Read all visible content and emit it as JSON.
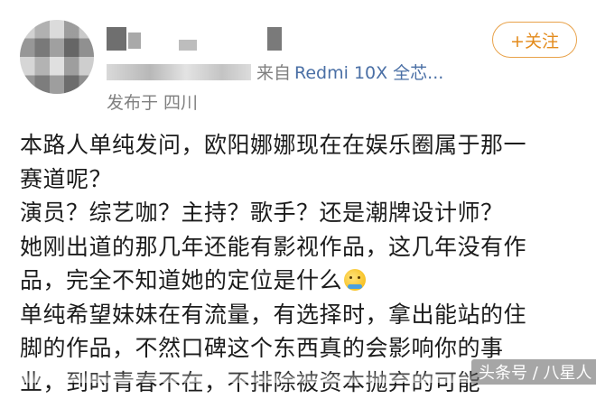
{
  "post": {
    "meta": {
      "source_label": "来自",
      "device": "Redmi 10X 全芯...",
      "location": "发布于 四川"
    },
    "follow_label": "+关注",
    "lines": [
      "本路人单纯发问，欧阳娜娜现在在娱乐圈属于那一",
      "赛道呢？",
      "演员？综艺咖？主持？歌手？还是潮牌设计师？",
      "她刚出道的那几年还能有影视作品，这几年没有作",
      "品，完全不知道她的定位是什么",
      "单纯希望妹妹在有流量，有选择时，拿出能站的住",
      "脚的作品，不然口碑这个东西真的会影响你的事",
      "业，到时青春不在，不排除被资本抛弃的可能"
    ],
    "emoji_icon": "shrug-emoji-icon"
  },
  "watermark": "头条号 / 八星人"
}
